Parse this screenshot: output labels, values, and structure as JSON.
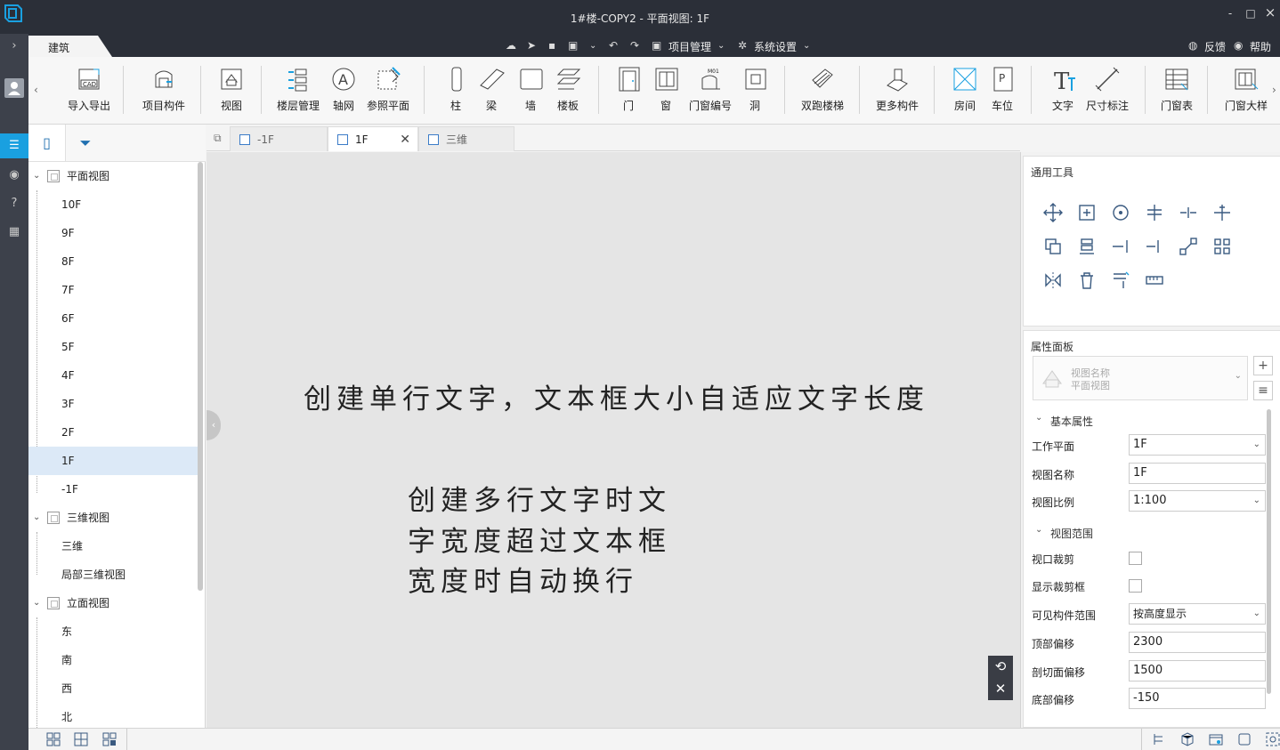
{
  "window": {
    "title": "1#楼-COPY2 - 平面视图: 1F",
    "minimize": "-",
    "maximize": "□",
    "close": "×"
  },
  "ribbon_tab": "建筑",
  "quick_access": {
    "project_mgmt": "项目管理",
    "system_settings": "系统设置",
    "feedback": "反馈",
    "help": "帮助"
  },
  "ribbon": {
    "import_export": "导入导出",
    "project_component": "项目构件",
    "view": "视图",
    "floor_mgmt": "楼层管理",
    "axis_grid": "轴网",
    "ref_plane": "参照平面",
    "column": "柱",
    "beam": "梁",
    "wall": "墙",
    "slab": "楼板",
    "door": "门",
    "window": "窗",
    "door_window_no": "门窗编号",
    "opening": "洞",
    "double_stair": "双跑楼梯",
    "more_components": "更多构件",
    "room": "房间",
    "parking": "车位",
    "text": "文字",
    "dimension": "尺寸标注",
    "door_window_table": "门窗表",
    "door_window_detail": "门窗大样"
  },
  "tree": {
    "plan_views": "平面视图",
    "floors": [
      "10F",
      "9F",
      "8F",
      "7F",
      "6F",
      "5F",
      "4F",
      "3F",
      "2F",
      "1F",
      "-1F"
    ],
    "selected": "1F",
    "views_3d": "三维视图",
    "items_3d": [
      "三维",
      "局部三维视图"
    ],
    "elevation_views": "立面视图",
    "elevations": [
      "东",
      "南",
      "西",
      "北"
    ]
  },
  "doc_tabs": [
    "-1F",
    "1F",
    "三维"
  ],
  "canvas": {
    "single_line": "创建单行文字，文本框大小自适应文字长度",
    "multi_lines": [
      "创建多行文字时文",
      "字宽度超过文本框",
      "宽度时自动换行"
    ]
  },
  "tools_panel": {
    "title": "通用工具"
  },
  "properties": {
    "title": "属性面板",
    "view_name_label": "视图名称",
    "view_name_value": "平面视图",
    "basic_section": "基本属性",
    "work_plane_label": "工作平面",
    "work_plane": "1F",
    "view_name_field_label": "视图名称",
    "view_name": "1F",
    "scale_label": "视图比例",
    "scale": "1:100",
    "range_section": "视图范围",
    "crop_label": "视口裁剪",
    "show_crop_label": "显示裁剪框",
    "visible_range_label": "可见构件范围",
    "visible_range": "按高度显示",
    "top_offset_label": "顶部偏移",
    "top_offset": "2300",
    "cut_offset_label": "剖切面偏移",
    "cut_offset": "1500",
    "bottom_offset_label": "底部偏移",
    "bottom_offset": "-150"
  },
  "colors": {
    "titlebar": "#2b2f38",
    "accent": "#1aa0e0",
    "canvas": "#e5e5e5",
    "selection": "#dce9f7"
  }
}
